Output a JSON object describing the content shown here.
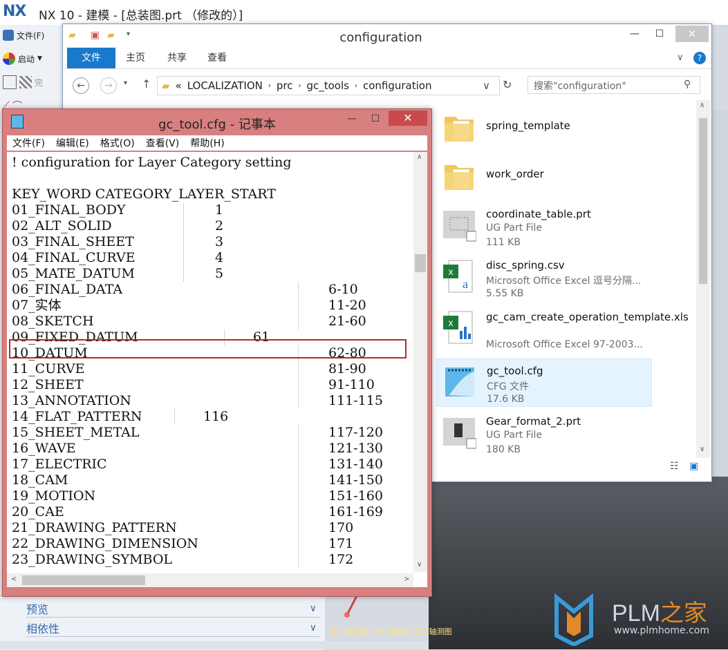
{
  "nx": {
    "logo": "NX",
    "title": "NX 10 - 建模 - [总装图.prt （修改的）]",
    "file_menu": "文件(F)",
    "start_menu": "启动",
    "toolbar_partial": "完",
    "panel_sections": [
      {
        "label": "预览"
      },
      {
        "label": "相依性"
      }
    ],
    "status": "正三轴测图 工作 摄像机 正三轴测图",
    "watermark": {
      "brand": "PLM",
      "brand_cn": "之家",
      "url": "www.plmhome.com"
    }
  },
  "explorer": {
    "title": "configuration",
    "ribbon_tabs": [
      {
        "label": "文件",
        "active": true
      },
      {
        "label": "主页"
      },
      {
        "label": "共享"
      },
      {
        "label": "查看"
      }
    ],
    "breadcrumb": [
      "«",
      "LOCALIZATION",
      "prc",
      "gc_tools",
      "configuration"
    ],
    "search_placeholder": "搜索\"configuration\"",
    "files": [
      {
        "name": "spring_template",
        "icon": "folder-icon"
      },
      {
        "name": "work_order",
        "icon": "folder-icon"
      },
      {
        "name": "coordinate_table.prt",
        "type": "UG Part File",
        "size": "111 KB",
        "icon": "ug-part-icon"
      },
      {
        "name": "disc_spring.csv",
        "type": "Microsoft Office Excel 逗号分隔...",
        "size": "5.55 KB",
        "icon": "excel-csv-icon"
      },
      {
        "name": "gc_cam_create_operation_template.xls",
        "type": "Microsoft Office Excel 97-2003...",
        "icon": "excel-icon"
      },
      {
        "name": "gc_tool.cfg",
        "type": "CFG 文件",
        "size": "17.6 KB",
        "icon": "notepad-file-icon",
        "selected": true
      },
      {
        "name": "Gear_format_2.prt",
        "type": "UG Part File",
        "size": "180 KB",
        "icon": "ug-part-icon"
      }
    ]
  },
  "notepad": {
    "title": "gc_tool.cfg - 记事本",
    "menus": [
      "文件(F)",
      "编辑(E)",
      "格式(O)",
      "查看(V)",
      "帮助(H)"
    ],
    "header_comment": "! configuration for Layer Category setting",
    "keyword_line": "KEY_WORD CATEGORY_LAYER_START",
    "rows": [
      {
        "name": "01_FINAL_BODY",
        "value": "1"
      },
      {
        "name": "02_ALT_SOLID",
        "value": "2"
      },
      {
        "name": "03_FINAL_SHEET",
        "value": "3"
      },
      {
        "name": "04_FINAL_CURVE",
        "value": "4"
      },
      {
        "name": "05_MATE_DATUM",
        "value": "5"
      },
      {
        "name": "06_FINAL_DATA",
        "value": "6-10"
      },
      {
        "name": "07_实体",
        "value": "11-20"
      },
      {
        "name": "08_SKETCH",
        "value": "21-60"
      },
      {
        "name": "09_FIXED_DATUM",
        "value": "61"
      },
      {
        "name": "10_DATUM",
        "value": "62-80"
      },
      {
        "name": "11_CURVE",
        "value": "81-90"
      },
      {
        "name": "12_SHEET",
        "value": "91-110"
      },
      {
        "name": "13_ANNOTATION",
        "value": "111-115"
      },
      {
        "name": "14_FLAT_PATTERN",
        "value": "116"
      },
      {
        "name": "15_SHEET_METAL",
        "value": "117-120"
      },
      {
        "name": "16_WAVE",
        "value": "121-130"
      },
      {
        "name": "17_ELECTRIC",
        "value": "131-140"
      },
      {
        "name": "18_CAM",
        "value": "141-150"
      },
      {
        "name": "19_MOTION",
        "value": "151-160"
      },
      {
        "name": "20_CAE",
        "value": "161-169"
      },
      {
        "name": "21_DRAWING_PATTERN",
        "value": "170"
      },
      {
        "name": "22_DRAWING_DIMENSION",
        "value": "171"
      },
      {
        "name": "23_DRAWING_SYMBOL",
        "value": "172"
      }
    ]
  }
}
